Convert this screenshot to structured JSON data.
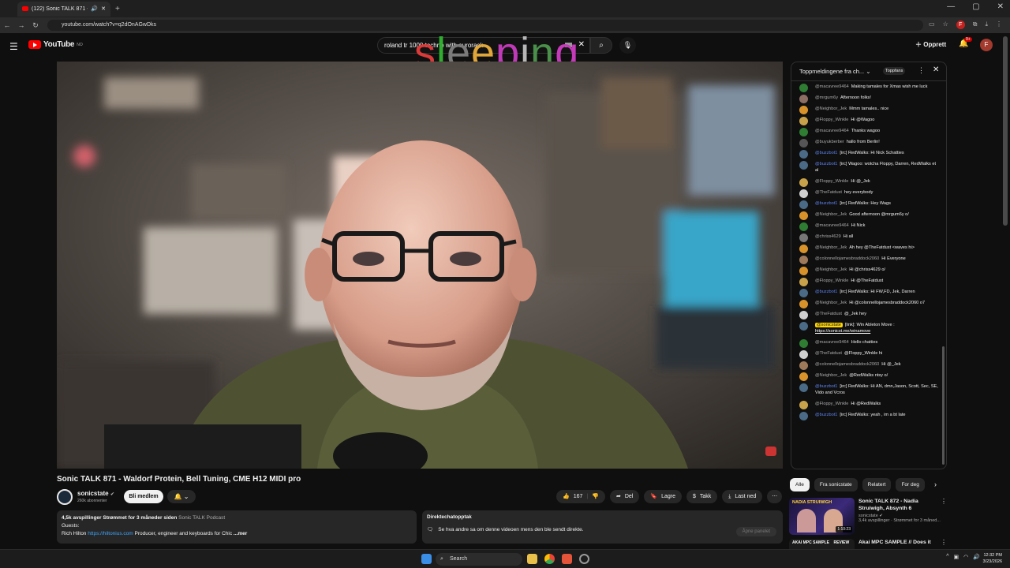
{
  "browser": {
    "tab_title": "(122) Sonic TALK 871 - Wal",
    "url": "youtube.com/watch?v=q2dOnAGwDks"
  },
  "header": {
    "logo_text": "YouTube",
    "logo_region": "NO",
    "search_value": "roland tr 1000 techno with eurorack",
    "create_label": "Opprett",
    "notif_count": "9+",
    "avatar_letter": "F"
  },
  "overlay": {
    "word": "sleeping",
    "colors": [
      "#d93a3a",
      "#2fae2f",
      "#7a7a7a",
      "#e0a63a",
      "#c03ab8",
      "#b7b7b7",
      "#4a8f4a",
      "#c43ab8"
    ]
  },
  "video": {
    "title": "Sonic TALK 871 - Waldorf Protein, Bell Tuning, CME H12 MIDI pro",
    "channel": "sonicstate",
    "subscribers": "260k abonnenter",
    "join_label": "Bli medlem",
    "likes": "167",
    "share_label": "Del",
    "save_label": "Lagre",
    "thanks_label": "Takk",
    "download_label": "Last ned"
  },
  "description": {
    "stats": "4,5k avspillinger  Strømmet for 3 måneder siden",
    "playlist": "Sonic TALK Podcast",
    "guests_label": "Guests:",
    "guest_name": "Rich Hilton",
    "guest_link": "https://hiltonius.com",
    "guest_desc": "Producer, engineer and keyboards for Chic",
    "more": "...mer"
  },
  "chat_replay": {
    "title": "Direktechatopptak",
    "text": "Se hva andre sa om denne videoen mens den ble sendt direkte.",
    "open_label": "Åpne panelet"
  },
  "livechat": {
    "header": "Toppmeldingene fra ch...",
    "topfans": "Toppfans",
    "messages": [
      {
        "author": "@macavree9464",
        "text": "Making tamales for Xmas wish me luck",
        "color": "#2e7d32"
      },
      {
        "author": "@mrgum6y",
        "text": "Afternoon folks!",
        "color": "#8d6e63"
      },
      {
        "author": "@Neighbor_Jek",
        "text": "Mmm tamales.. nice",
        "color": "#d8922a"
      },
      {
        "author": "@Floppy_Winkle",
        "text": "Hi @Wagoo",
        "color": "#c8a24a"
      },
      {
        "author": "@macavree9464",
        "text": "Thanks wagoo",
        "color": "#2e7d32"
      },
      {
        "author": "@buyukberber",
        "text": "hallo from Berlin!",
        "color": "#555555"
      },
      {
        "author": "@buzzbot1",
        "text": "[irc] RedWalks: Hi Nick Schatties",
        "color": "#4a6a86",
        "mod": true
      },
      {
        "author": "@buzzbot1",
        "text": "[irc] Wagoo: wotcha Floppy, Darren, RedWalks et al",
        "color": "#4a6a86",
        "mod": true
      },
      {
        "author": "@Floppy_Winkle",
        "text": "Hi @_Jek",
        "color": "#c8a24a"
      },
      {
        "author": "@TheFatdust",
        "text": "hey everybody",
        "color": "#cfcfcf"
      },
      {
        "author": "@buzzbot1",
        "text": "[irc] RedWalks: Hey Wags",
        "color": "#4a6a86",
        "mod": true
      },
      {
        "author": "@Neighbor_Jek",
        "text": "Good afternoon @mrgum6y o/",
        "color": "#d8922a"
      },
      {
        "author": "@macavree9464",
        "text": "Hi Nick",
        "color": "#2e7d32"
      },
      {
        "author": "@chriss4629",
        "text": "Hi all",
        "color": "#777777"
      },
      {
        "author": "@Neighbor_Jek",
        "text": "Ah hey @TheFatdust <waves hi>",
        "color": "#d8922a"
      },
      {
        "author": "@colonnellojamesbraddock2060",
        "text": "Hi Everyone",
        "color": "#9e7a5a"
      },
      {
        "author": "@Neighbor_Jek",
        "text": "Hi @chriss4629 o/",
        "color": "#d8922a"
      },
      {
        "author": "@Floppy_Winkle",
        "text": "Hi @TheFatdust",
        "color": "#c8a24a"
      },
      {
        "author": "@buzzbot1",
        "text": "[irc] RedWalks: Hi FW,FD, Jek, Darren",
        "color": "#4a6a86",
        "mod": true
      },
      {
        "author": "@Neighbor_Jek",
        "text": "Hi @colonnellojamesbraddock2060 o7",
        "color": "#d8922a"
      },
      {
        "author": "@TheFatdust",
        "text": "@_Jek hey",
        "color": "#cfcfcf"
      },
      {
        "author": "@sonicstate",
        "text": "[link]: Win Ableton Move : ",
        "link": "https://sonicst.me/winamove",
        "color": "#4a6a86",
        "owner": true
      },
      {
        "author": "@macavree9464",
        "text": "Hello chatties",
        "color": "#2e7d32"
      },
      {
        "author": "@TheFatdust",
        "text": "@Floppy_Winkle hi",
        "color": "#cfcfcf"
      },
      {
        "author": "@colonnellojamesbraddock2060",
        "text": "Hi @_Jek",
        "color": "#9e7a5a"
      },
      {
        "author": "@Neighbor_Jek",
        "text": "@RedWalks ntsy o/",
        "color": "#d8922a"
      },
      {
        "author": "@buzzbot1",
        "text": "[irc] RedWalks: Hi AN, dmn,Jason, Scott, Sec, SE, Vido and Vcros",
        "color": "#4a6a86",
        "mod": true
      },
      {
        "author": "@Floppy_Winkle",
        "text": "Hi @RedWalks",
        "color": "#c8a24a"
      },
      {
        "author": "@buzzbot1",
        "text": "[irc] RedWalks: yeah , im a bt late",
        "color": "#4a6a86",
        "mod": true
      }
    ]
  },
  "chips": [
    "Alle",
    "Fra sonicstate",
    "Relatert",
    "For deg"
  ],
  "recommendations": [
    {
      "title": "Sonic TALK 872 - Nadia Struiwigh, Absynth 6",
      "channel": "sonicstate",
      "meta": "3,4k avspillinger · Strømmet for 3 måned...",
      "duration": "1:10:23",
      "thumb_text": "NADIA STRUIWIGH"
    },
    {
      "title": "Akai MPC SAMPLE // Does it",
      "channel": "",
      "meta": "",
      "duration": "",
      "thumb_text": "AKAI MPC SAMPLE    REVIEW"
    }
  ],
  "taskbar": {
    "search_label": "Search",
    "time": "12:32 PM",
    "date": "3/23/2026"
  }
}
